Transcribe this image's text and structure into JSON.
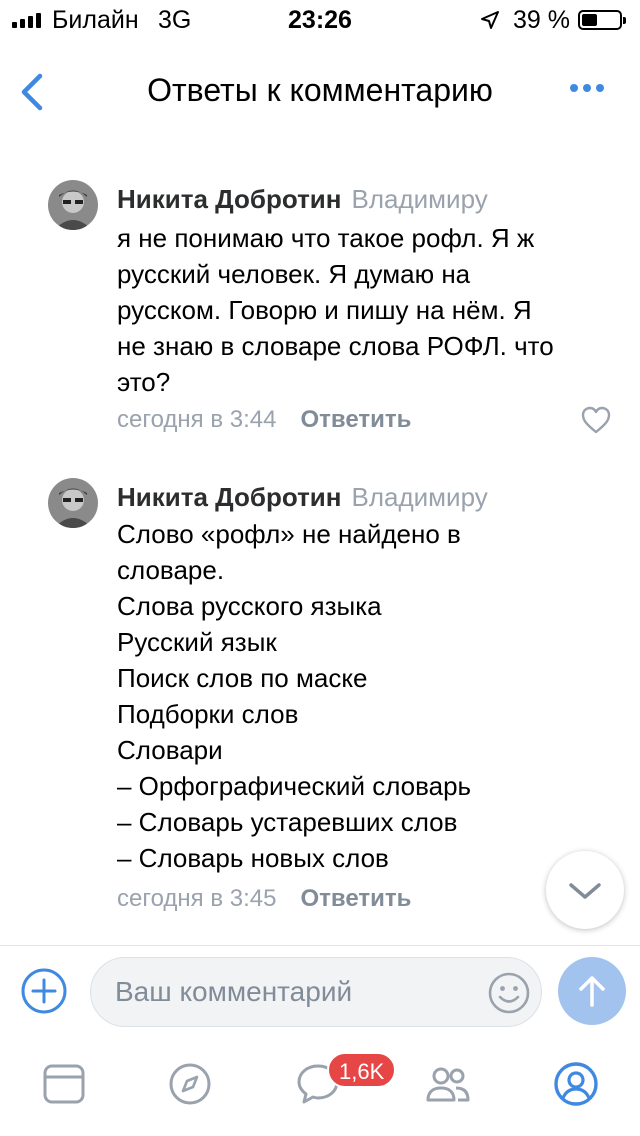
{
  "status_bar": {
    "carrier": "Билайн",
    "network": "3G",
    "time": "23:26",
    "battery_percent": "39 %"
  },
  "nav": {
    "title": "Ответы к комментарию",
    "back_icon": "chevron-left-icon",
    "more_icon": "more-dots-icon"
  },
  "comments": [
    {
      "author": "Никита Добротин",
      "reply_to": "Владимиру",
      "lines": [
        "я не понимаю что такое рофл. Я ж",
        "русский человек. Я думаю на",
        "русском. Говорю и пишу на нём. Я",
        "не знаю в словаре слова РОФЛ. что",
        "это?"
      ],
      "date": "сегодня в 3:44",
      "reply_label": "Ответить"
    },
    {
      "author": "Никита Добротин",
      "reply_to": "Владимиру",
      "lines": [
        "Слово «рофл» не найдено в",
        "словаре.",
        "Слова русского языка",
        "Русский язык",
        "Поиск слов по маске",
        "Подборки слов",
        "Словари",
        "– Орфографический словарь",
        "– Словарь устаревших слов",
        "– Словарь новых слов"
      ],
      "date": "сегодня в 3:45",
      "reply_label": "Ответить"
    }
  ],
  "composer": {
    "placeholder": "Ваш комментарий"
  },
  "tab_bar": {
    "messages_badge": "1,6K"
  },
  "colors": {
    "accent": "#3f8ae0",
    "secondary_text": "#99a2ad",
    "badge": "#e64646",
    "send_button": "#a3c3ef"
  }
}
